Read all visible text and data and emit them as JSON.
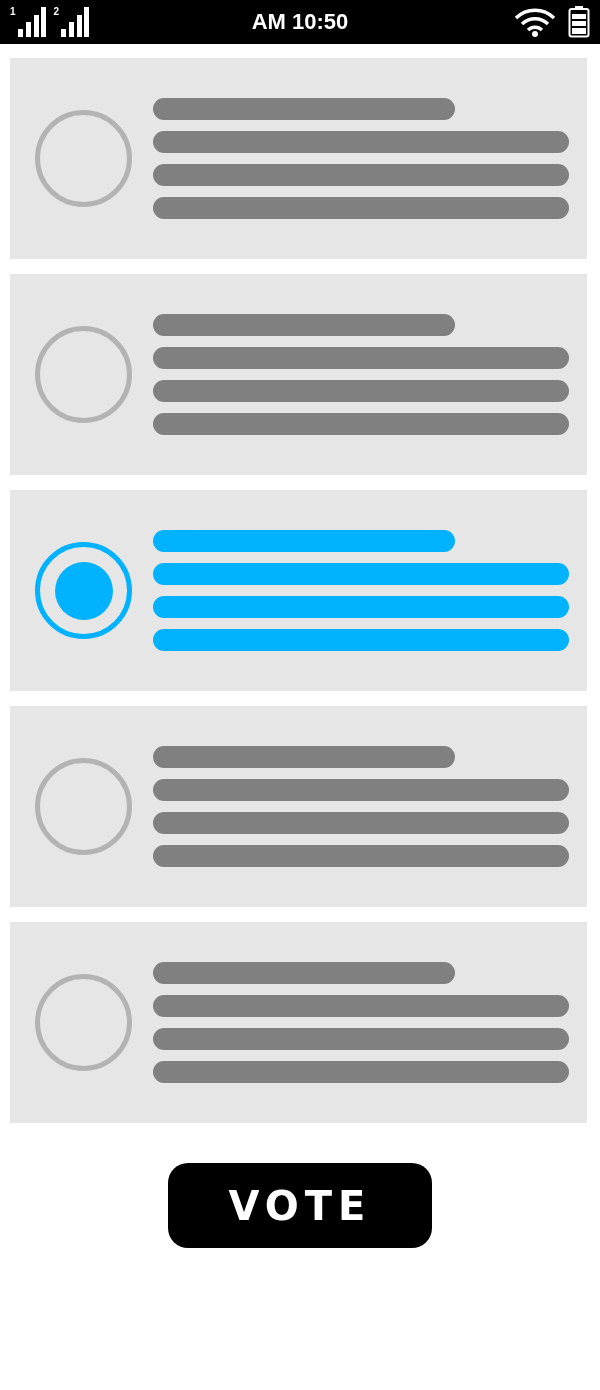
{
  "status_bar": {
    "sim_labels": [
      "1",
      "2"
    ],
    "time": "AM 10:50"
  },
  "options": [
    {
      "selected": false
    },
    {
      "selected": false
    },
    {
      "selected": true
    },
    {
      "selected": false
    },
    {
      "selected": false
    }
  ],
  "vote_button": {
    "label": "VOTE"
  }
}
